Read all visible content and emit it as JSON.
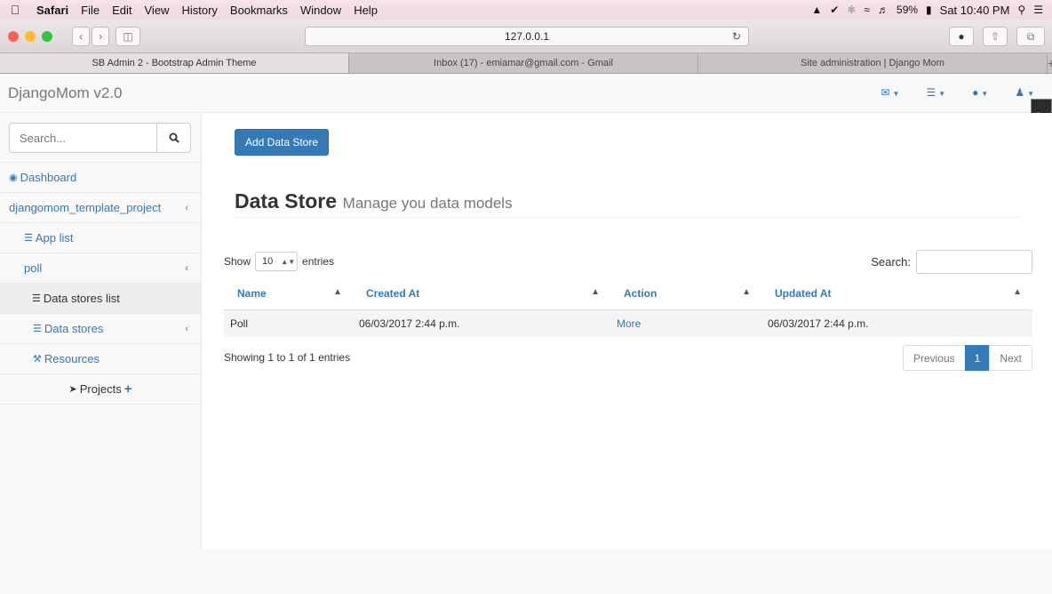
{
  "menubar": {
    "app": "Safari",
    "items": [
      "File",
      "Edit",
      "View",
      "History",
      "Bookmarks",
      "Window",
      "Help"
    ],
    "battery": "59%",
    "clock": "Sat 10:40 PM"
  },
  "browser": {
    "url": "127.0.0.1",
    "tabs": [
      {
        "title": "SB Admin 2 - Bootstrap Admin Theme"
      },
      {
        "title": "Inbox (17) - emiamar@gmail.com - Gmail"
      },
      {
        "title": "Site administration | Django Mom"
      }
    ]
  },
  "navbar": {
    "brand": "DjangoMom v2.0",
    "debug_toolbar": "DjDT"
  },
  "sidebar": {
    "search_placeholder": "Search...",
    "dashboard": "Dashboard",
    "project": "djangomom_template_project",
    "app_list": "App list",
    "poll": "poll",
    "data_stores_list": "Data stores list",
    "data_stores": "Data stores",
    "resources": "Resources",
    "projects": "Projects"
  },
  "main": {
    "add_button": "Add Data Store",
    "title": "Data Store",
    "subtitle": "Manage you data models",
    "show_label": "Show",
    "entries_value": "10",
    "entries_label": "entries",
    "search_label": "Search:",
    "columns": [
      "Name",
      "Created At",
      "Action",
      "Updated At"
    ],
    "rows": [
      {
        "name": "Poll",
        "created_at": "06/03/2017 2:44 p.m.",
        "action": "More",
        "updated_at": "06/03/2017 2:44 p.m."
      }
    ],
    "info": "Showing 1 to 1 of 1 entries",
    "pagination": {
      "previous": "Previous",
      "current": "1",
      "next": "Next"
    }
  },
  "colors": {
    "primary": "#337ab7",
    "sidebar_bg": "#f8f8f8"
  }
}
